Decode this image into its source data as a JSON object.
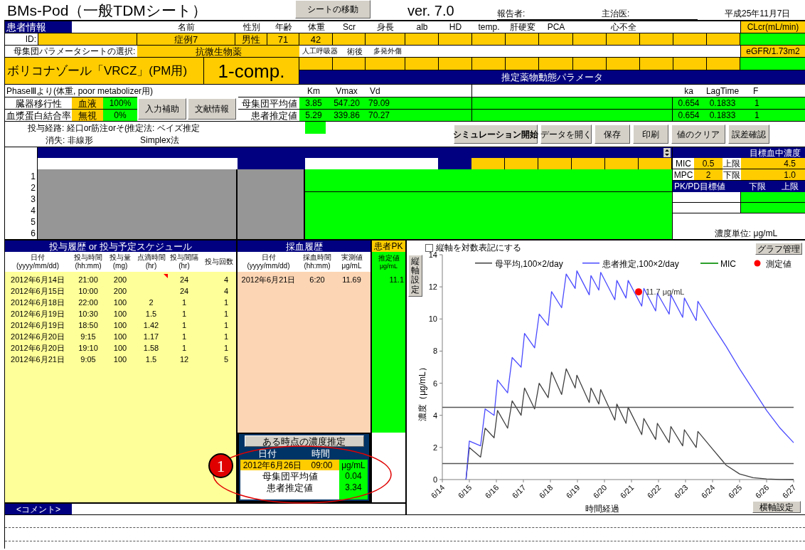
{
  "title": "BMs-Pod（一般TDMシート）",
  "header": {
    "move_sheet_button": "シートの移動",
    "version": "ver. 7.0",
    "reporter_label": "報告者:",
    "doctor_label": "主治医:",
    "date": "平成25年11月7日"
  },
  "patient": {
    "section_label": "患者情報",
    "columns": [
      {
        "label": "名前"
      },
      {
        "label": "性別"
      },
      {
        "label": "年齢"
      },
      {
        "label": "体重"
      },
      {
        "label": "Scr"
      },
      {
        "label": "身長"
      },
      {
        "label": "alb"
      },
      {
        "label": "HD"
      },
      {
        "label": "temp."
      },
      {
        "label": "肝硬変"
      },
      {
        "label": "PCA"
      },
      {
        "label": "心不全"
      }
    ],
    "clcr_label": "CLcr(mL/min)",
    "id_label": "ID:",
    "values": [
      "症例7",
      "男性",
      "71",
      "42"
    ],
    "param_sheet_label": "母集団パラメータシートの選択:",
    "param_sheet": "抗微生物薬",
    "flags": [
      "人工呼吸器",
      "術後",
      "多発外傷"
    ],
    "egfr_label": "eGFR/1.73m2"
  },
  "drug": {
    "name": "ボリコナゾール「VRCZ」(PM用)",
    "model": "1-comp."
  },
  "pk_params": {
    "title": "推定薬物動態パラメータ",
    "source": "PhaseⅢより(体重, poor metabolizer用)",
    "columns": [
      "Km",
      "Vmax",
      "Vd"
    ],
    "abs_columns": [
      "ka",
      "LagTime",
      "F"
    ],
    "rows": [
      {
        "label": "母集団平均値",
        "values": [
          "3.85",
          "547.20",
          "79.09"
        ],
        "abs_values": [
          "0.654",
          "0.1833",
          "1"
        ]
      },
      {
        "label": "患者推定値",
        "values": [
          "5.29",
          "339.86",
          "70.27"
        ],
        "abs_values": [
          "0.654",
          "0.1833",
          "1"
        ]
      }
    ]
  },
  "transfer": [
    {
      "label": "臓器移行性",
      "value": "血液",
      "percent": "100%"
    },
    {
      "label": "血漿蛋白結合率",
      "value": "無視",
      "percent": "0%"
    }
  ],
  "side_buttons": [
    "入力補助",
    "文献情報"
  ],
  "route": "投与経路: 経口or筋注orそ(",
  "estimation": "推定法: ベイズ推定",
  "elimination": "消失: 非線形",
  "method": "Simplex法",
  "action_buttons": [
    "シミュレーション開始",
    "データを開く",
    "保存",
    "印刷",
    "値のクリア",
    "誤差確認"
  ],
  "row_numbers": [
    "1",
    "2",
    "3",
    "4",
    "5",
    "6"
  ],
  "target": {
    "title": "目標血中濃度",
    "rows": [
      {
        "label": "MIC",
        "value": "0.5",
        "limit_label": "上限",
        "limit": "4.5"
      },
      {
        "label": "MPC",
        "value": "2",
        "limit_label": "下限",
        "limit": "1.0"
      }
    ],
    "pkpd_label": "PK/PD目標値",
    "pkpd_columns": [
      "下限",
      "上限"
    ],
    "unit_text": "濃度単位: μg/mL"
  },
  "dosing": {
    "title": "投与履歴 or 投与予定スケジュール",
    "columns": [
      {
        "label": "日付",
        "unit": "(yyyy/mm/dd)"
      },
      {
        "label": "投与時間",
        "unit": "(hh:mm)"
      },
      {
        "label": "投与量",
        "unit": "(mg)"
      },
      {
        "label": "点滴時間",
        "unit": "(hr)"
      },
      {
        "label": "投与間隔",
        "unit": "(hr)"
      },
      {
        "label": "投与回数"
      }
    ],
    "rows": [
      {
        "date": "2012年6月14日",
        "time": "21:00",
        "dose": "200",
        "interval": "24",
        "count": "4",
        "has_comment": true
      },
      {
        "date": "2012年6月15日",
        "time": "10:00",
        "dose": "200",
        "interval": "24",
        "count": "4"
      },
      {
        "date": "2012年6月18日",
        "time": "22:00",
        "dose": "100",
        "infusion": "2",
        "interval": "1",
        "count": "1"
      },
      {
        "date": "2012年6月19日",
        "time": "10:30",
        "dose": "100",
        "infusion": "1.5",
        "interval": "1",
        "count": "1"
      },
      {
        "date": "2012年6月19日",
        "time": "18:50",
        "dose": "100",
        "infusion": "1.42",
        "interval": "1",
        "count": "1"
      },
      {
        "date": "2012年6月20日",
        "time": "9:15",
        "dose": "100",
        "infusion": "1.17",
        "interval": "1",
        "count": "1"
      },
      {
        "date": "2012年6月20日",
        "time": "19:10",
        "dose": "100",
        "infusion": "1.58",
        "interval": "1",
        "count": "1"
      },
      {
        "date": "2012年6月21日",
        "time": "9:05",
        "dose": "100",
        "infusion": "1.5",
        "interval": "12",
        "count": "5"
      }
    ]
  },
  "sampling": {
    "title": "採血履歴",
    "columns": [
      {
        "label": "日付",
        "unit": "(yyyy/mm/dd)"
      },
      {
        "label": "採血時間",
        "unit": "(hh:mm)"
      },
      {
        "label": "実測値",
        "unit": "μg/mL"
      }
    ],
    "rows": [
      {
        "date": "2012年6月21日",
        "time": "6:20",
        "measured": "11.69"
      }
    ]
  },
  "patient_pk": {
    "title": "患者PK",
    "column": "推定値",
    "unit": "μg/mL",
    "values": [
      "11.1"
    ]
  },
  "point_estimate": {
    "button": "ある時点の濃度推定",
    "date_label": "日付",
    "time_label": "時間",
    "date": "2012年6月26日",
    "time": "09:00",
    "unit": "μg/mL",
    "rows": [
      {
        "label": "母集団平均値",
        "value": "0.04"
      },
      {
        "label": "患者推定値",
        "value": "3.34"
      }
    ]
  },
  "callout": "1",
  "comment_label": "<コメント>",
  "chart": {
    "log_checkbox": {
      "label": "縦軸を対数表記にする",
      "checked": false
    },
    "graph_button": "グラフ管理",
    "y_axis_button": "縦軸設定",
    "x_axis_button": "横軸設定",
    "legend_extra": [
      {
        "kind": "line",
        "label": "MIC",
        "color": "#2ca02c"
      },
      {
        "kind": "dot",
        "label": "測定値",
        "color": "#ff0000"
      }
    ],
    "chart_data": {
      "type": "line",
      "xlabel": "時間経過",
      "ylabel": "濃度（μg/mL）",
      "x": [
        "2012-06-14T00:00",
        "2012-06-14T21:00",
        "2012-06-15T00:00",
        "2012-06-15T10:00",
        "2012-06-15T14:00",
        "2012-06-15T22:00",
        "2012-06-16T01:00",
        "2012-06-16T10:00",
        "2012-06-16T14:00",
        "2012-06-16T22:00",
        "2012-06-17T01:00",
        "2012-06-17T10:00",
        "2012-06-17T14:00",
        "2012-06-17T22:00",
        "2012-06-18T01:00",
        "2012-06-18T10:00",
        "2012-06-18T14:00",
        "2012-06-18T22:00",
        "2012-06-18T23:30",
        "2012-06-19T10:30",
        "2012-06-19T12:00",
        "2012-06-19T19:00",
        "2012-06-19T20:40",
        "2012-06-20T09:15",
        "2012-06-20T11:00",
        "2012-06-20T19:10",
        "2012-06-20T21:00",
        "2012-06-21T09:05",
        "2012-06-21T11:00",
        "2012-06-21T21:30",
        "2012-06-21T23:00",
        "2012-06-22T09:30",
        "2012-06-22T11:00",
        "2012-06-22T21:30",
        "2012-06-22T23:00",
        "2012-06-23T09:30",
        "2012-06-23T11:00",
        "2012-06-24T00:00",
        "2012-06-24T12:00",
        "2012-06-25T00:00",
        "2012-06-25T12:00",
        "2012-06-26T00:00",
        "2012-06-26T12:00",
        "2012-06-27T00:00"
      ],
      "series": [
        {
          "name": "母平均,100×2/day",
          "color": "#404040",
          "values": [
            null,
            0,
            2.0,
            1.4,
            3.2,
            2.6,
            4.3,
            3.2,
            4.9,
            4.0,
            5.7,
            4.4,
            6.0,
            5.1,
            6.7,
            5.3,
            6.9,
            5.7,
            6.5,
            4.8,
            5.7,
            4.7,
            5.6,
            3.7,
            4.7,
            3.5,
            4.5,
            2.8,
            3.8,
            2.5,
            3.5,
            2.3,
            3.3,
            2.1,
            3.1,
            2.0,
            3.0,
            1.9,
            0.9,
            0.35,
            0.12,
            0.04,
            0.01,
            0
          ]
        },
        {
          "name": "患者推定,100×2/day",
          "color": "#4a4aff",
          "values": [
            null,
            0,
            2.4,
            2.1,
            4.4,
            4.0,
            6.2,
            5.4,
            7.6,
            7.0,
            9.1,
            8.2,
            10.3,
            9.6,
            11.7,
            10.7,
            12.8,
            11.9,
            13.0,
            11.5,
            12.7,
            11.8,
            12.9,
            11.2,
            12.4,
            11.3,
            12.4,
            10.8,
            11.9,
            10.5,
            11.6,
            10.3,
            11.5,
            10.1,
            11.3,
            9.9,
            11.1,
            9.6,
            8.3,
            6.9,
            5.6,
            4.3,
            3.2,
            2.3
          ]
        },
        {
          "color": "#555555",
          "values": [
            4.5,
            4.5,
            4.5,
            4.5,
            4.5,
            4.5,
            4.5,
            4.5,
            4.5,
            4.5,
            4.5,
            4.5,
            4.5,
            4.5,
            4.5,
            4.5,
            4.5,
            4.5,
            4.5,
            4.5,
            4.5,
            4.5,
            4.5,
            4.5,
            4.5,
            4.5,
            4.5,
            4.5,
            4.5,
            4.5,
            4.5,
            4.5,
            4.5,
            4.5,
            4.5,
            4.5,
            4.5,
            4.5,
            4.5,
            4.5,
            4.5,
            4.5,
            4.5,
            4.5
          ]
        },
        {
          "color": "#555555",
          "values": [
            1,
            1,
            1,
            1,
            1,
            1,
            1,
            1,
            1,
            1,
            1,
            1,
            1,
            1,
            1,
            1,
            1,
            1,
            1,
            1,
            1,
            1,
            1,
            1,
            1,
            1,
            1,
            1,
            1,
            1,
            1,
            1,
            1,
            1,
            1,
            1,
            1,
            1,
            1,
            1,
            1,
            1,
            1,
            1
          ]
        }
      ],
      "xlim": [
        "2012-06-14",
        "2012-06-27"
      ],
      "ylim": [
        0,
        14
      ],
      "xticks": [
        {
          "value": "2012-06-14",
          "label": "6/14"
        },
        {
          "value": "2012-06-15",
          "label": "6/15"
        },
        {
          "value": "2012-06-16",
          "label": "6/16"
        },
        {
          "value": "2012-06-17",
          "label": "6/17"
        },
        {
          "value": "2012-06-18",
          "label": "6/18"
        },
        {
          "value": "2012-06-19",
          "label": "6/19"
        },
        {
          "value": "2012-06-20",
          "label": "6/20"
        },
        {
          "value": "2012-06-21",
          "label": "6/21"
        },
        {
          "value": "2012-06-22",
          "label": "6/22"
        },
        {
          "value": "2012-06-23",
          "label": "6/23"
        },
        {
          "value": "2012-06-24",
          "label": "6/24"
        },
        {
          "value": "2012-06-25",
          "label": "6/25"
        },
        {
          "value": "2012-06-26",
          "label": "6/26"
        },
        {
          "value": "2012-06-27",
          "label": "6/27"
        }
      ],
      "yticks": [
        0,
        2,
        4,
        6,
        8,
        10,
        12,
        14
      ],
      "legend": "top",
      "annotations": [
        {
          "x": "2012-06-21T06:20",
          "y": 11.69,
          "text": "11.7 μg/mL"
        }
      ]
    }
  }
}
